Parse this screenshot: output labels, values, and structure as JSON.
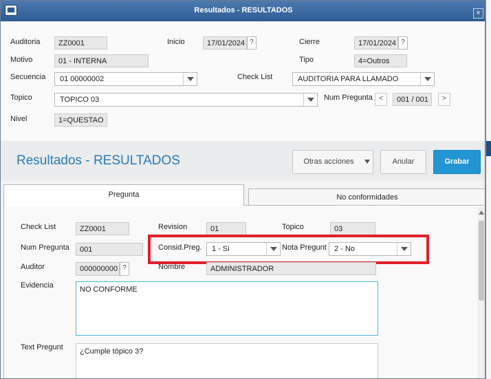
{
  "window": {
    "title": "Resultados - RESULTADOS",
    "close_label": "×"
  },
  "header": {
    "auditoria_label": "Auditoria",
    "auditoria_value": "ZZ0001",
    "inicio_label": "Inicio",
    "inicio_value": "17/01/2024",
    "cierre_label": "Cierre",
    "cierre_value": "17/01/2024",
    "motivo_label": "Motivo",
    "motivo_value": "01 - INTERNA",
    "tipo_label": "Tipo",
    "tipo_value": "4=Outros",
    "secuencia_label": "Secuencia",
    "secuencia_value": "01 00000002",
    "checklist_label": "Check List",
    "checklist_value": "AUDITORIA PARA LLAMADO",
    "topico_label": "Topico",
    "topico_value": "TOPICO 03",
    "numpregunta_label": "Num Pregunta",
    "numpregunta_value": "001 / 001",
    "prev_label": "<",
    "next_label": ">",
    "nivel_label": "Nivel",
    "nivel_value": "1=QUESTAO",
    "help_label": "?"
  },
  "toolbar": {
    "title": "Resultados - RESULTADOS",
    "otras_label": "Otras acciones",
    "anular_label": "Anular",
    "grabar_label": "Grabar"
  },
  "tabs": [
    {
      "label": "Pregunta",
      "active": true
    },
    {
      "label": "No conformidades",
      "active": false
    }
  ],
  "form": {
    "checklist_label": "Check List",
    "checklist_value": "ZZ0001",
    "revision_label": "Revision",
    "revision_value": "01",
    "topico_label": "Topico",
    "topico_value": "03",
    "numpregunta_label": "Num Pregunta",
    "numpregunta_value": "001",
    "consid_label": "Consid.Preg.",
    "consid_value": "1 - Si",
    "nota_label": "Nota Pregunt",
    "nota_value": "2 - No",
    "auditor_label": "Auditor",
    "auditor_value": "000000000",
    "nombre_label": "Nombre",
    "nombre_value": "ADMINISTRADOR",
    "evidencia_label": "Evidencia",
    "evidencia_value": "NO CONFORME",
    "textpregunt_label": "Text Pregunt",
    "textpregunt_value": "¿Cumple tópico 3?"
  },
  "colors": {
    "accent": "#2196d3",
    "title_blue": "#2a7bb5",
    "highlight": "#e0202a"
  }
}
